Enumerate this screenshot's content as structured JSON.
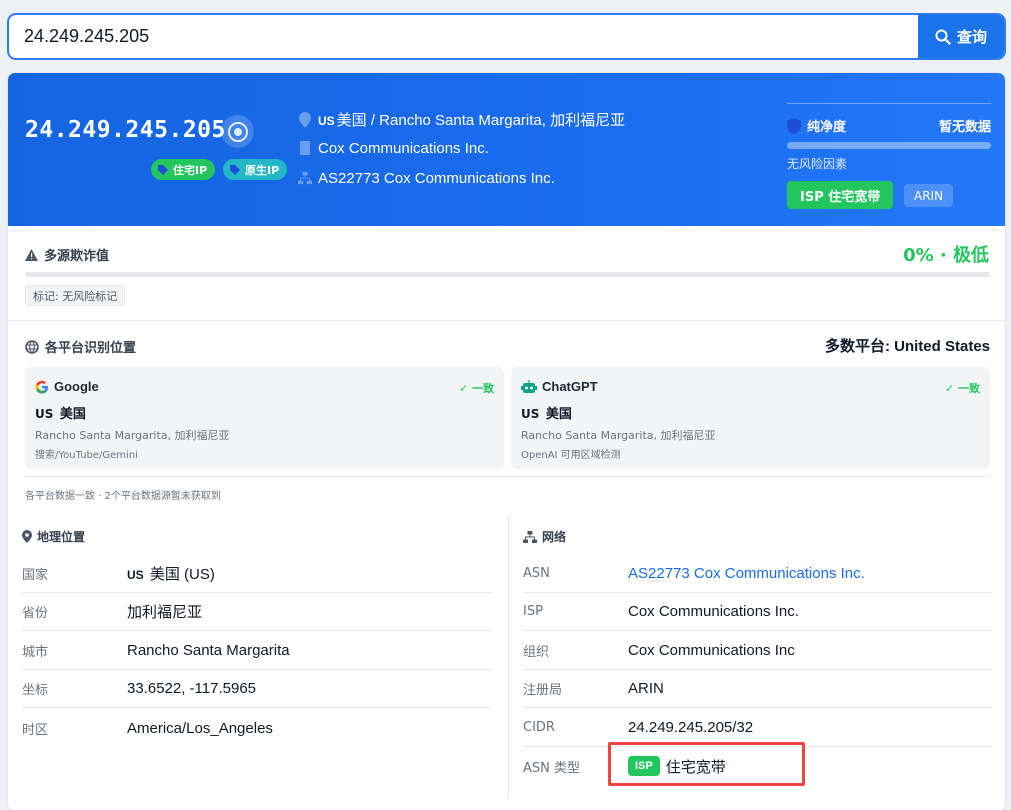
{
  "search": {
    "value": "24.249.245.205",
    "button_label": "查询"
  },
  "hero": {
    "ip": "24.249.245.205",
    "tags": [
      "住宅IP",
      "原生IP"
    ],
    "location_cc": "US",
    "location": "美国 / Rancho Santa Margarita, 加利福尼亚",
    "org": "Cox Communications Inc.",
    "asn": "AS22773 Cox Communications Inc.",
    "purity_label": "纯净度",
    "purity_value": "暂无数据",
    "purity_sub": "无风险因素",
    "isp_badge": "ISP 住宅宽带",
    "registry_badge": "ARIN"
  },
  "fraud": {
    "title": "多源欺诈值",
    "value": "0% · 极低",
    "mark": "标记: 无风险标记"
  },
  "platforms": {
    "title": "各平台识别位置",
    "majority": "多数平台: United States",
    "cards": [
      {
        "name": "Google",
        "status": "✓ 一致",
        "cc": "US",
        "country": "美国",
        "city": "Rancho Santa Margarita, 加利福尼亚",
        "note": "搜索/YouTube/Gemini"
      },
      {
        "name": "ChatGPT",
        "status": "✓ 一致",
        "cc": "US",
        "country": "美国",
        "city": "Rancho Santa Margarita, 加利福尼亚",
        "note": "OpenAI 可用区域检测"
      }
    ],
    "footer": "各平台数据一致 · 2个平台数据源暂未获取到"
  },
  "geo": {
    "title": "地理位置",
    "rows": [
      {
        "k": "国家",
        "cc": "US",
        "v": "美国 (US)"
      },
      {
        "k": "省份",
        "v": "加利福尼亚"
      },
      {
        "k": "城市",
        "v": "Rancho Santa Margarita"
      },
      {
        "k": "坐标",
        "v": "33.6522, -117.5965"
      },
      {
        "k": "时区",
        "v": "America/Los_Angeles"
      }
    ]
  },
  "network": {
    "title": "网络",
    "rows": [
      {
        "k": "ASN",
        "v": "AS22773 Cox Communications Inc."
      },
      {
        "k": "ISP",
        "v": "Cox Communications Inc."
      },
      {
        "k": "组织",
        "v": "Cox Communications Inc"
      },
      {
        "k": "注册局",
        "v": "ARIN"
      },
      {
        "k": "CIDR",
        "v": "24.249.245.205/32"
      },
      {
        "k": "ASN 类型",
        "badge": "ISP",
        "v": "住宅宽带"
      }
    ]
  },
  "colors": {
    "brand_blue": "#1a6ce8",
    "success_green": "#22c55e",
    "highlight_red": "#ef4444"
  },
  "icons": [
    "search-icon",
    "eye-icon",
    "tag-icon",
    "location-pin-icon",
    "building-icon",
    "network-icon",
    "shield-icon",
    "warning-icon",
    "globe-icon",
    "google-icon",
    "robot-icon"
  ]
}
